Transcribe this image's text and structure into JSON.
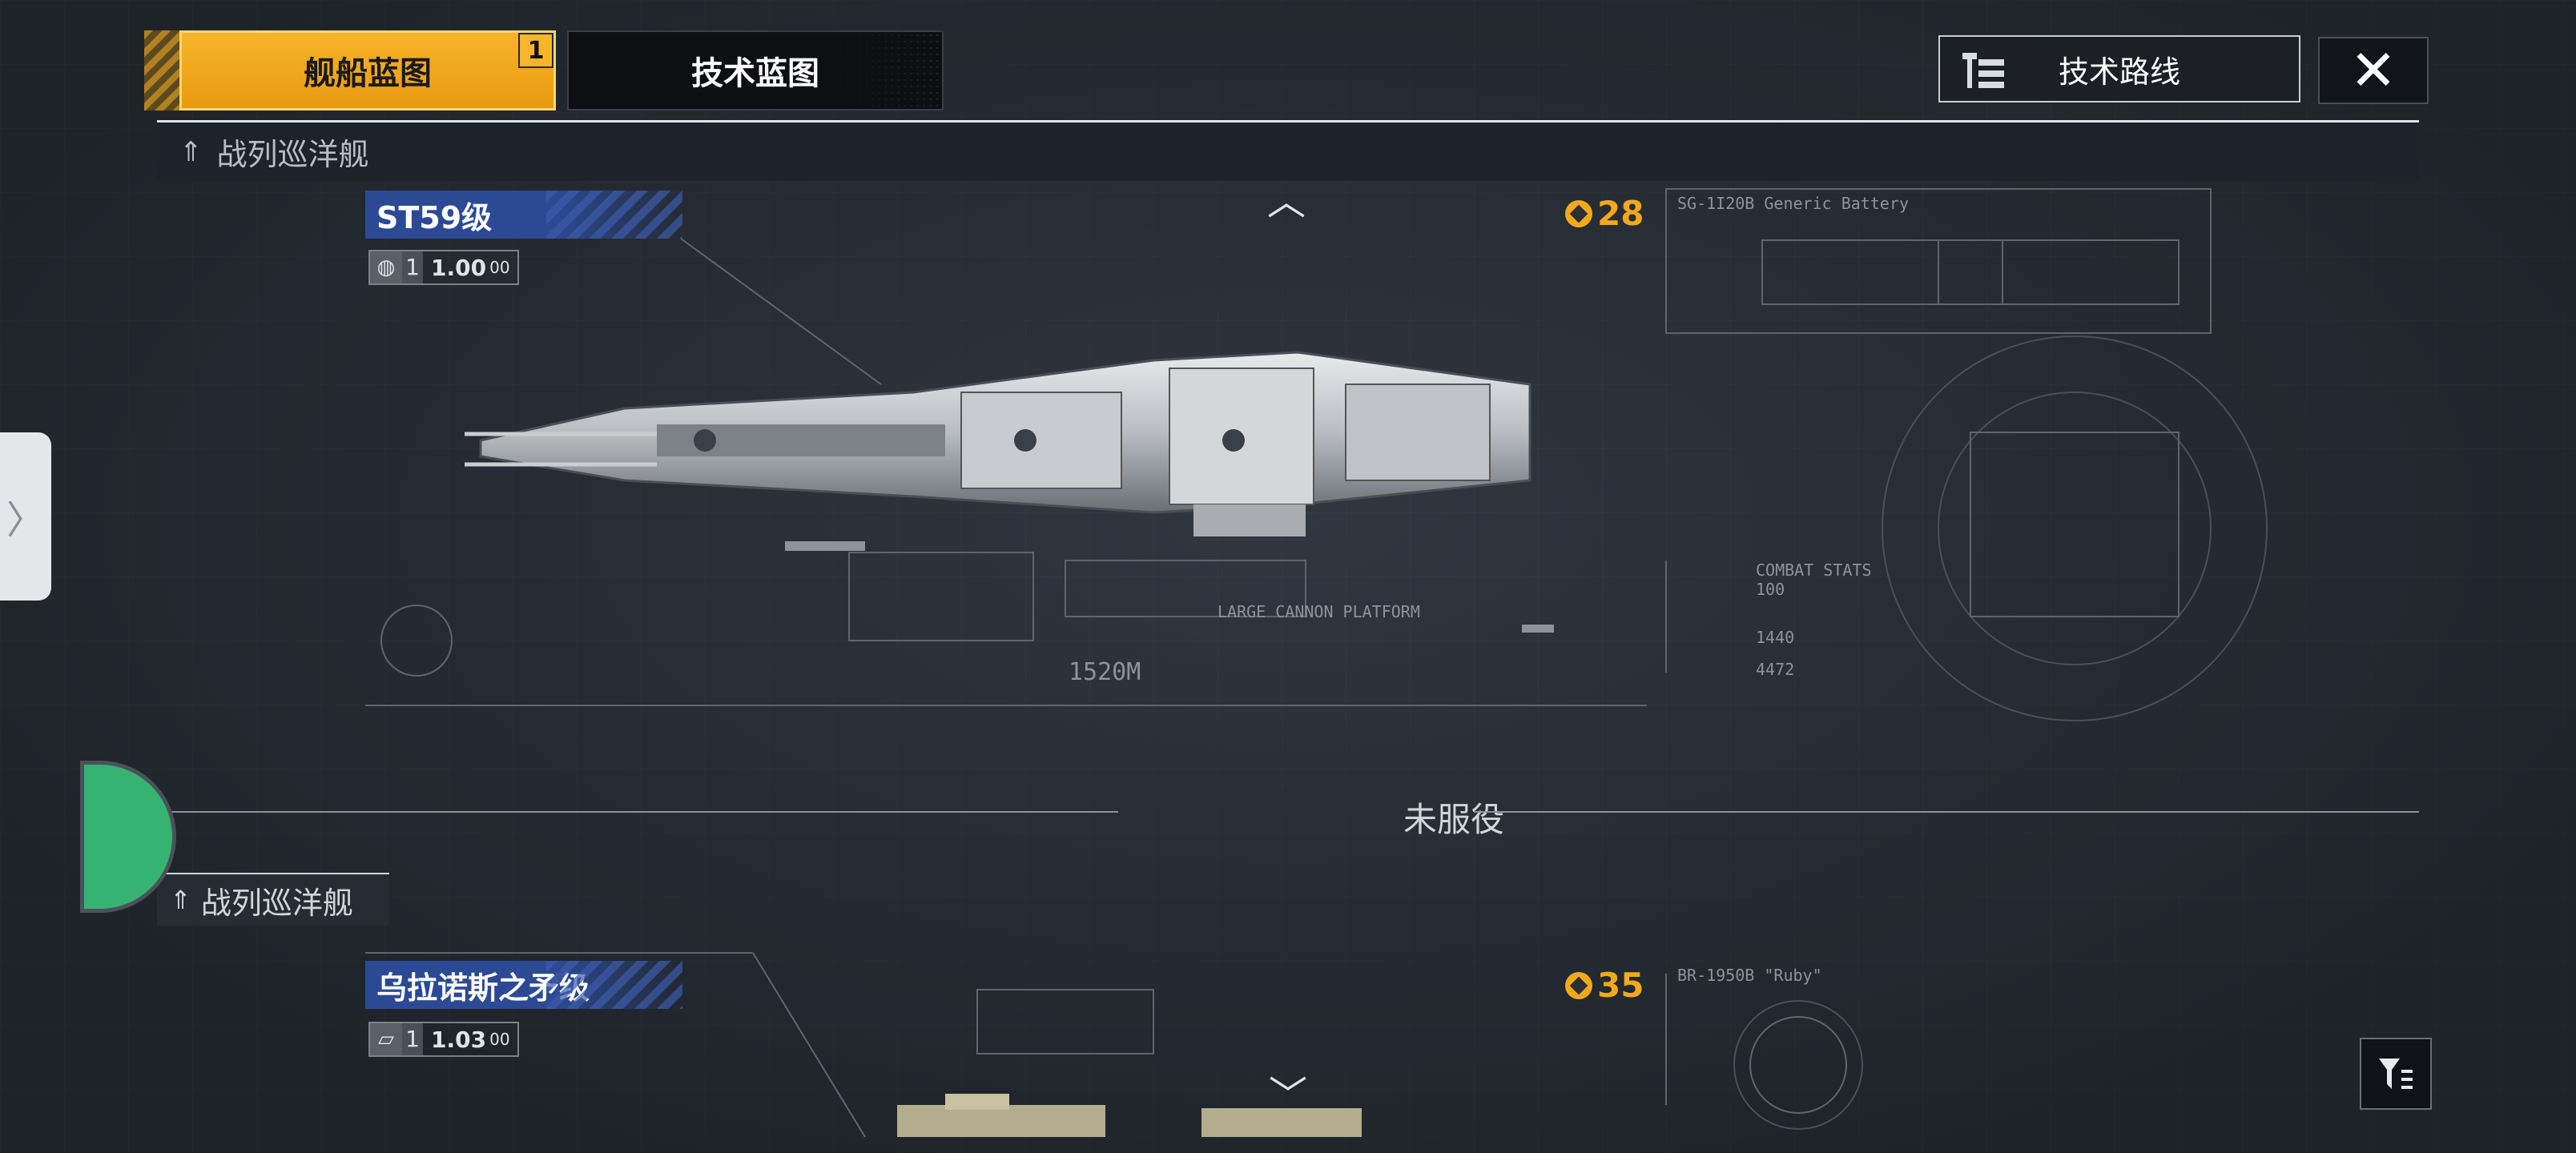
{
  "tabs": [
    {
      "label": "舰船蓝图",
      "badge": "1",
      "active": true
    },
    {
      "label": "技术蓝图",
      "active": false
    }
  ],
  "tech_route": {
    "label": "技术路线",
    "icon": "tree-list-icon"
  },
  "close": {
    "icon": "close-icon",
    "glyph": "✕"
  },
  "section": {
    "label": "战列巡洋舰"
  },
  "ship1": {
    "name": "ST59级",
    "level": "1",
    "version": "1.00",
    "version_suffix": "00",
    "score": "28",
    "dimension": "1520M",
    "battery_label": "SG-1I20B Generic Battery",
    "platform_label": "LARGE CANNON PLATFORM",
    "stats": [
      "COMBAT STATS",
      "100",
      "1440",
      "4472"
    ]
  },
  "divider": {
    "label": "未服役"
  },
  "section2": {
    "label": "战列巡洋舰"
  },
  "ship2": {
    "name": "乌拉诺斯之矛级",
    "level": "1",
    "version": "1.03",
    "version_suffix": "00",
    "score": "35",
    "battery_label": "BR-1950B \"Ruby\""
  },
  "colors": {
    "accent": "#f2a91b",
    "name_banner": "#2c4a94",
    "status_green": "#36b371"
  }
}
